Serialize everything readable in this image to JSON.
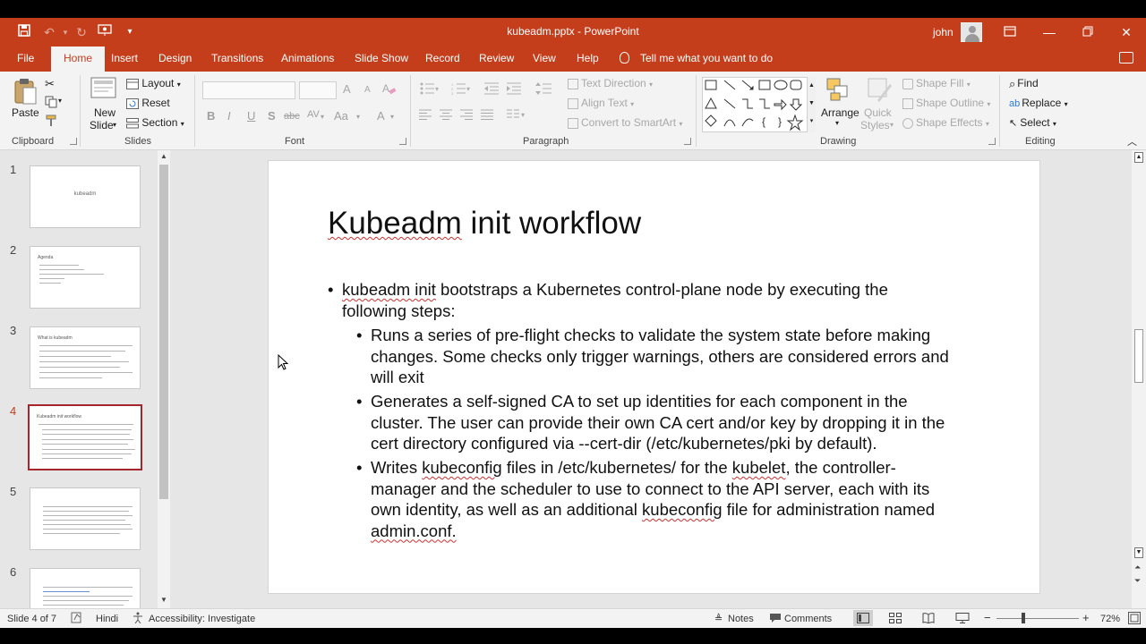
{
  "window": {
    "title": "kubeadm.pptx  -  PowerPoint",
    "user": "john"
  },
  "tabs": [
    "File",
    "Home",
    "Insert",
    "Design",
    "Transitions",
    "Animations",
    "Slide Show",
    "Record",
    "Review",
    "View",
    "Help"
  ],
  "active_tab": "Home",
  "tell_me": "Tell me what you want to do",
  "ribbon": {
    "clipboard": {
      "paste": "Paste",
      "label": "Clipboard"
    },
    "slides": {
      "new_slide_1": "New",
      "new_slide_2": "Slide",
      "layout": "Layout",
      "reset": "Reset",
      "section": "Section",
      "label": "Slides"
    },
    "font": {
      "label": "Font",
      "bold": "B",
      "italic": "I",
      "underline": "U",
      "shadow": "S",
      "strike": "abc",
      "spacing": "AV",
      "color": "A",
      "grow": "A",
      "shrink": "A"
    },
    "paragraph": {
      "text_direction": "Text Direction",
      "align_text": "Align Text",
      "smartart": "Convert to SmartArt",
      "label": "Paragraph"
    },
    "drawing": {
      "arrange": "Arrange",
      "quick_styles_1": "Quick",
      "quick_styles_2": "Styles",
      "shape_fill": "Shape Fill",
      "shape_outline": "Shape Outline",
      "shape_effects": "Shape Effects",
      "label": "Drawing"
    },
    "editing": {
      "find": "Find",
      "replace": "Replace",
      "select": "Select",
      "label": "Editing"
    }
  },
  "thumbnails": [
    {
      "num": "1",
      "title": "",
      "center": "kubeadm"
    },
    {
      "num": "2",
      "title": "Agenda",
      "center": ""
    },
    {
      "num": "3",
      "title": "What is kubeadm",
      "center": ""
    },
    {
      "num": "4",
      "title": "Kubeadm init workflow",
      "center": ""
    },
    {
      "num": "5",
      "title": "",
      "center": ""
    },
    {
      "num": "6",
      "title": "",
      "center": ""
    }
  ],
  "active_slide": 4,
  "slide": {
    "title": "Kubeadm init workflow",
    "b1_a": "kubeadm init",
    "b1_b": " bootstraps a Kubernetes control-plane node by executing the",
    "b1_c": "following steps:",
    "b2_l1": "Runs a series of pre-flight checks to validate the system state before making",
    "b2_l2": "changes. Some checks only trigger warnings, others are considered errors and",
    "b2_l3": "will exit",
    "b3_l1": "Generates a self-signed CA to set up identities for each component in the",
    "b3_l2": "cluster. The user can provide their own CA cert and/or key by dropping it in the",
    "b3_l3": "cert directory configured via --cert-dir (/etc/kubernetes/pki by default).",
    "b4_a": "Writes ",
    "b4_b": "kubeconfig",
    "b4_c": " files in /etc/kubernetes/ for the ",
    "b4_d": "kubelet",
    "b4_e": ", the controller-",
    "b4_l2": "manager and the scheduler to use to connect to the API server, each with its",
    "b4_l3a": "own identity, as well as an additional ",
    "b4_l3b": "kubeconfig",
    "b4_l3c": " file for administration named",
    "b4_l4": "admin.conf."
  },
  "status": {
    "slide_of": "Slide 4 of 7",
    "language": "Hindi",
    "accessibility": "Accessibility: Investigate",
    "notes": "Notes",
    "comments": "Comments",
    "zoom": "72%"
  },
  "colors": {
    "accent": "#c43e1c",
    "active_thumb": "#a4262c"
  }
}
